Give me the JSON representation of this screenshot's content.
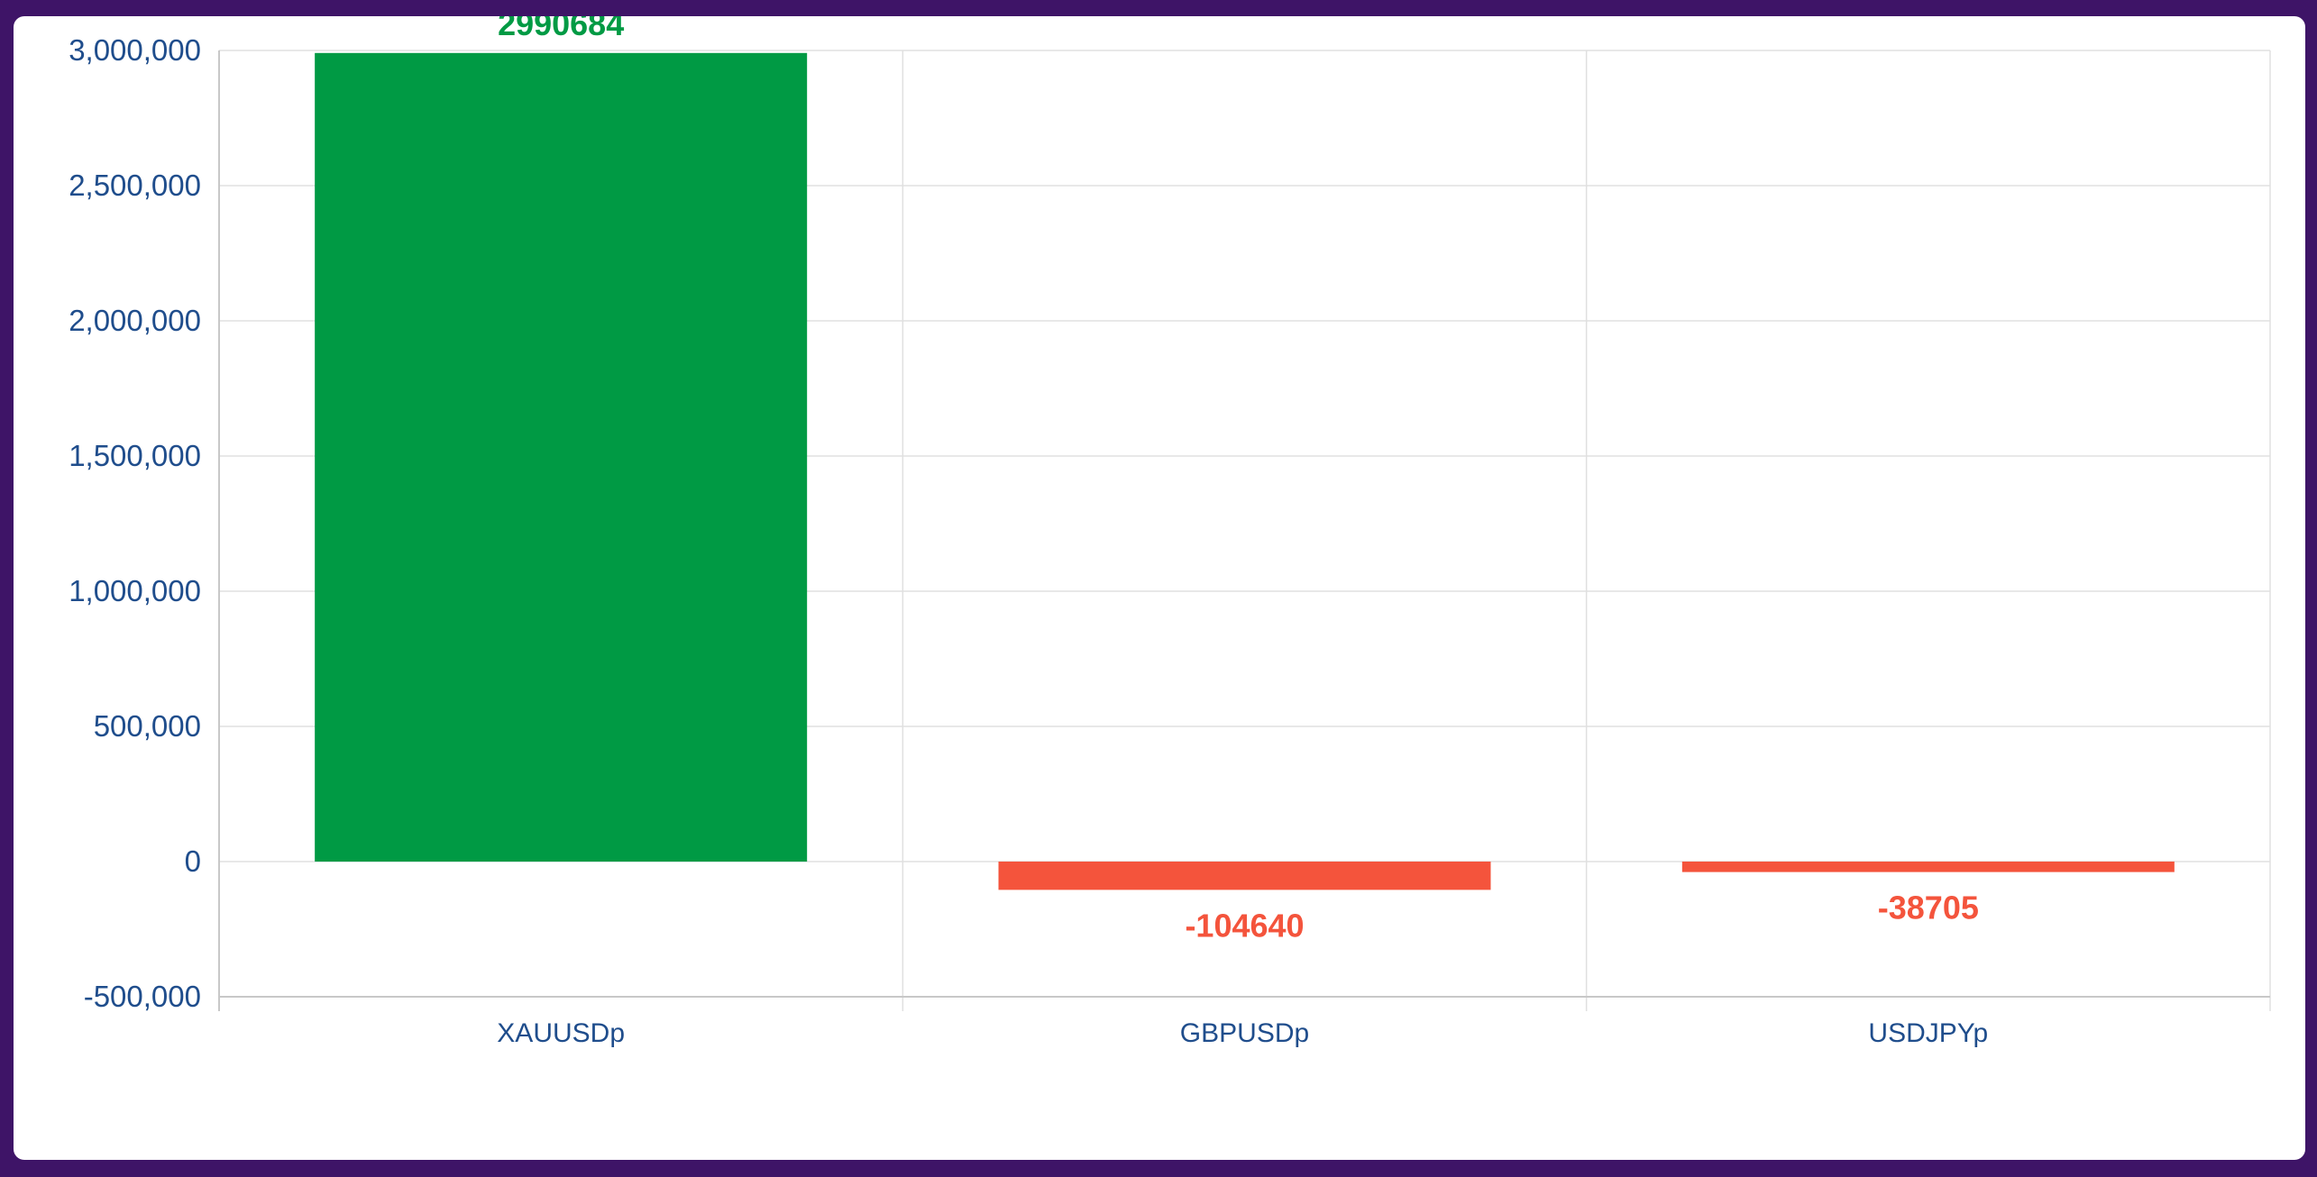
{
  "chart_data": {
    "type": "bar",
    "categories": [
      "XAUUSDp",
      "GBPUSDp",
      "USDJPYp"
    ],
    "values": [
      2990684,
      -104640,
      -38705
    ],
    "data_labels": [
      "2990684",
      "-104640",
      "-38705"
    ],
    "title": "",
    "xlabel": "",
    "ylabel": "",
    "ylim": [
      -500000,
      3000000
    ],
    "y_ticks": [
      {
        "value": 3000000,
        "label": "3,000,000"
      },
      {
        "value": 2500000,
        "label": "2,500,000"
      },
      {
        "value": 2000000,
        "label": "2,000,000"
      },
      {
        "value": 1500000,
        "label": "1,500,000"
      },
      {
        "value": 1000000,
        "label": "1,000,000"
      },
      {
        "value": 500000,
        "label": "500,000"
      },
      {
        "value": 0,
        "label": "0"
      },
      {
        "value": -500000,
        "label": "-500,000"
      }
    ],
    "grid": true,
    "legend": "none",
    "colors": {
      "positive": "#009a44",
      "negative": "#f4543c",
      "tick_text": "#1f4d8c",
      "grid": "#e0e0e0",
      "frame": "#3e1467"
    }
  }
}
